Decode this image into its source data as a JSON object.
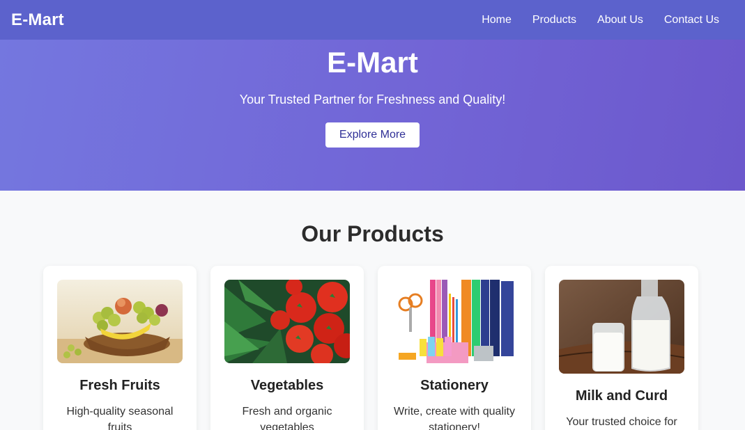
{
  "nav": {
    "brand": "E-Mart",
    "links": [
      "Home",
      "Products",
      "About Us",
      "Contact Us"
    ]
  },
  "hero": {
    "title": "E-Mart",
    "subtitle": "Your Trusted Partner for Freshness and Quality!",
    "button": "Explore More"
  },
  "products": {
    "title": "Our Products",
    "items": [
      {
        "name": "Fresh Fruits",
        "desc": "High-quality seasonal fruits",
        "icon": "fruit-basket-image"
      },
      {
        "name": "Vegetables",
        "desc": "Fresh and organic vegetables",
        "icon": "vegetables-image"
      },
      {
        "name": "Stationery",
        "desc": "Write, create with quality stationery!",
        "icon": "stationery-image"
      },
      {
        "name": "Milk and Curd",
        "desc": "Your trusted choice for",
        "icon": "milk-image"
      }
    ]
  },
  "colors": {
    "navbar": "#5c62cc",
    "hero_start": "#7477df",
    "hero_end": "#6c58cc",
    "page_bg": "#f8f9fa"
  }
}
